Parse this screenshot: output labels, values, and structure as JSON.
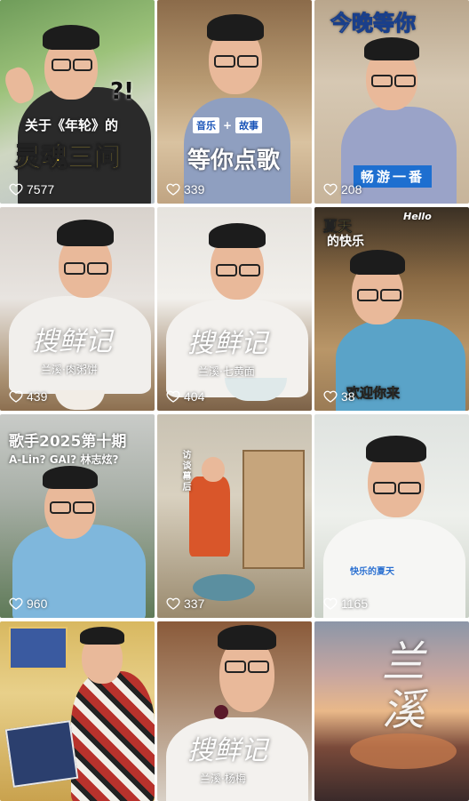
{
  "tiles": [
    {
      "likes": "7577",
      "caption_top": "关于《年轮》的",
      "caption_main": "灵魂三问",
      "mark": "?!"
    },
    {
      "likes": "339",
      "tag1": "音乐",
      "tag_sep": "+",
      "tag2": "故事",
      "caption_main": "等你点歌"
    },
    {
      "likes": "208",
      "caption_top": "今晚等你",
      "caption_main": "畅游一番"
    },
    {
      "likes": "439",
      "script": "搜鲜记",
      "sub": "兰溪·肉粥饼"
    },
    {
      "likes": "404",
      "script": "搜鲜记",
      "sub": "兰溪·七黄面"
    },
    {
      "likes": "38",
      "caption_top_a": "夏天",
      "caption_top_b": "的快乐",
      "hello": "Hello",
      "caption_main": "欢迎你来"
    },
    {
      "likes": "960",
      "caption_top": "歌手2025第十期",
      "caption_sub": "A-Lin? GAI? 林志炫?"
    },
    {
      "likes": "337",
      "caption_vert": "访谈幕后"
    },
    {
      "likes": "1165",
      "caption_main": "快乐的夏天"
    },
    {
      "likes": ""
    },
    {
      "likes": "",
      "script": "搜鲜记",
      "sub": "兰溪·杨梅"
    },
    {
      "likes": "",
      "script": "兰溪"
    }
  ]
}
